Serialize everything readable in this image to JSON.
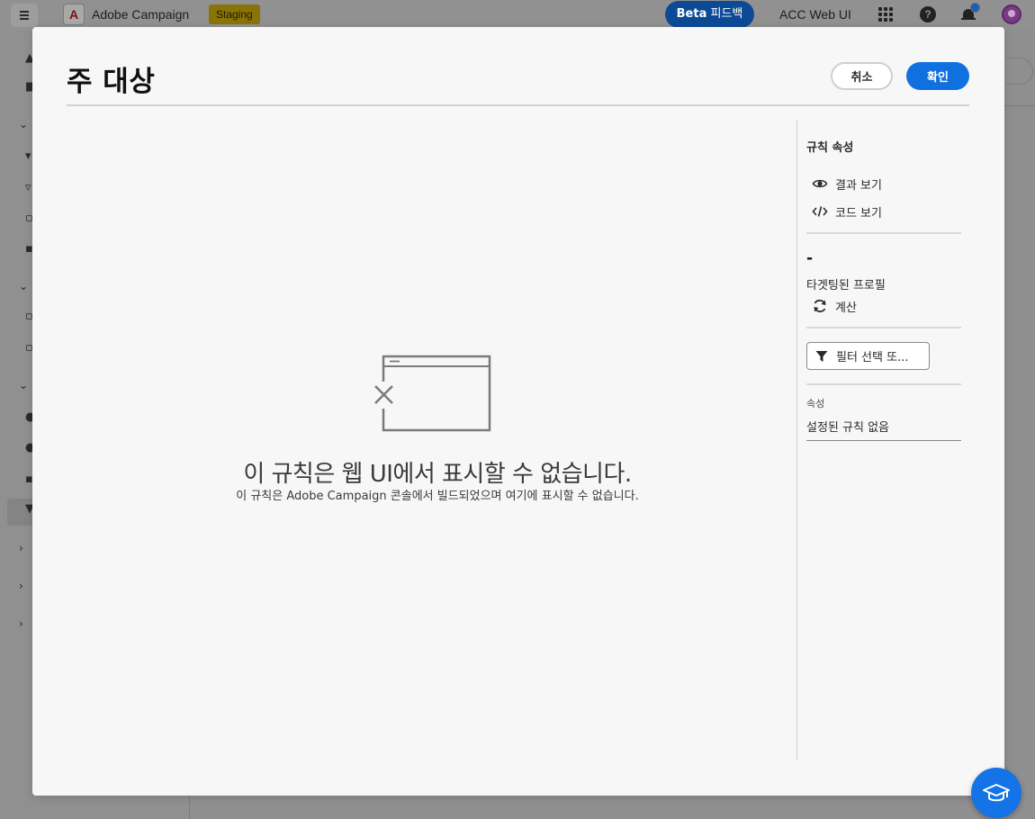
{
  "topbar": {
    "app_logo_letter": "A",
    "app_name": "Adobe Campaign",
    "env_badge": "Staging",
    "beta_prefix": "Beta",
    "beta_label": "피드백",
    "workspace_name": "ACC Web UI",
    "help_glyph": "?"
  },
  "modal": {
    "title": "주 대상",
    "cancel_label": "취소",
    "confirm_label": "확인"
  },
  "empty_state": {
    "title": "이 규칙은 웹 UI에서 표시할 수 없습니다.",
    "description": "이 규칙은 Adobe Campaign 콘솔에서 빌드되었으며 여기에 표시할 수 없습니다."
  },
  "right_panel": {
    "title": "규칙 속성",
    "view_results": "결과 보기",
    "view_code": "코드 보기",
    "count_value": "-",
    "targeted_profiles_label": "타겟팅된 프로필",
    "compute_label": "계산",
    "filter_button": "필터 선택 또...",
    "attributes_label": "속성",
    "attributes_value": "설정된 규칙 없음"
  },
  "colors": {
    "accent": "#1170e0",
    "beta_bg": "#0d4a96",
    "staging_bg": "#8a7407",
    "modal_bg": "#f7f7f7",
    "overlay_bg": "#8f8f8f"
  },
  "icons": {
    "menu": "hamburger-icon",
    "apps": "app-grid-icon",
    "help": "help-icon",
    "notifications": "bell-icon",
    "empty_state": "broken-window-icon",
    "view_results": "eye-icon",
    "view_code": "code-icon",
    "compute": "refresh-icon",
    "filter": "funnel-icon",
    "learn": "graduation-cap-icon"
  }
}
